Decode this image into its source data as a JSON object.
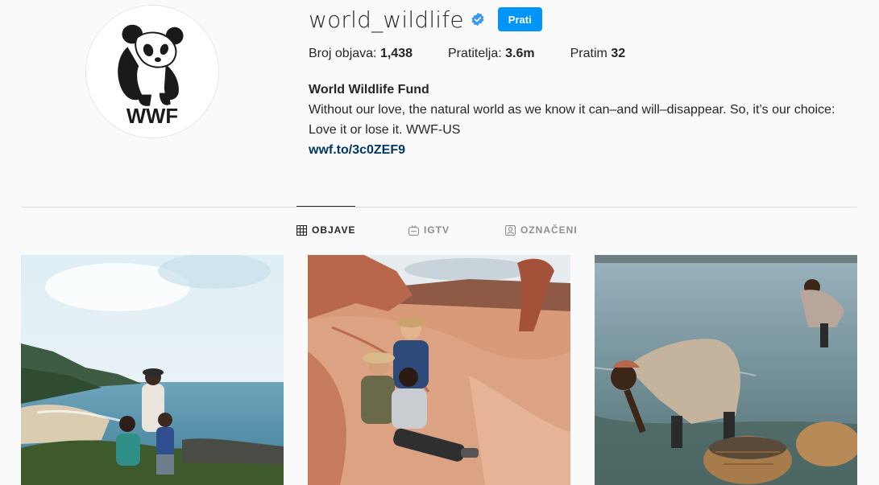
{
  "profile": {
    "username": "world_wildlife",
    "follow_label": "Prati",
    "avatar_text": "WWF",
    "stats": {
      "posts_label": "Broj objava:",
      "posts_value": "1,438",
      "followers_label": "Pratitelja:",
      "followers_value": "3.6m",
      "following_label": "Pratim",
      "following_value": "32"
    },
    "bio": {
      "name": "World Wildlife Fund",
      "text": "Without our love, the natural world as we know it can–and will–disappear. So, it’s our choice: Love it or lose it. WWF-US",
      "link": "wwf.to/3c0ZEF9"
    }
  },
  "tabs": [
    {
      "label": "OBJAVE",
      "icon": "grid-icon",
      "active": true
    },
    {
      "label": "IGTV",
      "icon": "igtv-icon",
      "active": false
    },
    {
      "label": "OZNAČENI",
      "icon": "tagged-icon",
      "active": false
    }
  ],
  "posts": [
    {
      "description_icon": "family-coast-photo"
    },
    {
      "description_icon": "family-red-rocks-photo"
    },
    {
      "description_icon": "women-gathering-sea-photo"
    }
  ],
  "colors": {
    "accent": "#0095f6",
    "link": "#00376b",
    "background": "#fafafa"
  }
}
